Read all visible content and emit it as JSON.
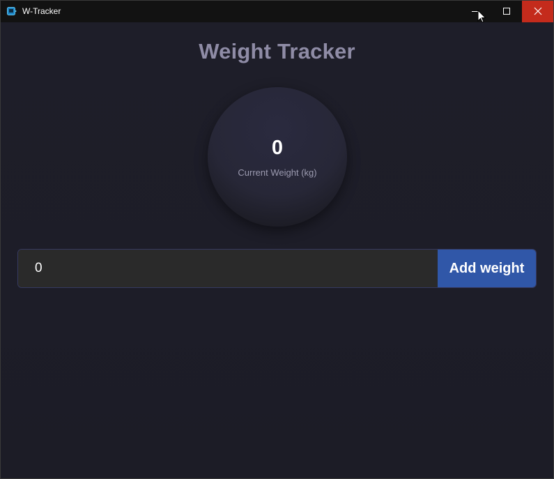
{
  "window": {
    "title": "W-Tracker",
    "icons": {
      "app": "app-icon",
      "minimize": "minimize-icon",
      "maximize": "maximize-icon",
      "close": "close-icon",
      "cursor": "mouse-cursor-icon"
    },
    "colors": {
      "titlebar": "#121212",
      "close_hover": "#c42b1c"
    }
  },
  "header": {
    "title": "Weight Tracker"
  },
  "current_weight": {
    "value": "0",
    "label": "Current Weight (kg)"
  },
  "form": {
    "input_value": "0",
    "add_label": "Add weight"
  },
  "theme": {
    "background": "#1d1d27",
    "accent": "#3057a8",
    "title_color": "#8f8ca6"
  }
}
